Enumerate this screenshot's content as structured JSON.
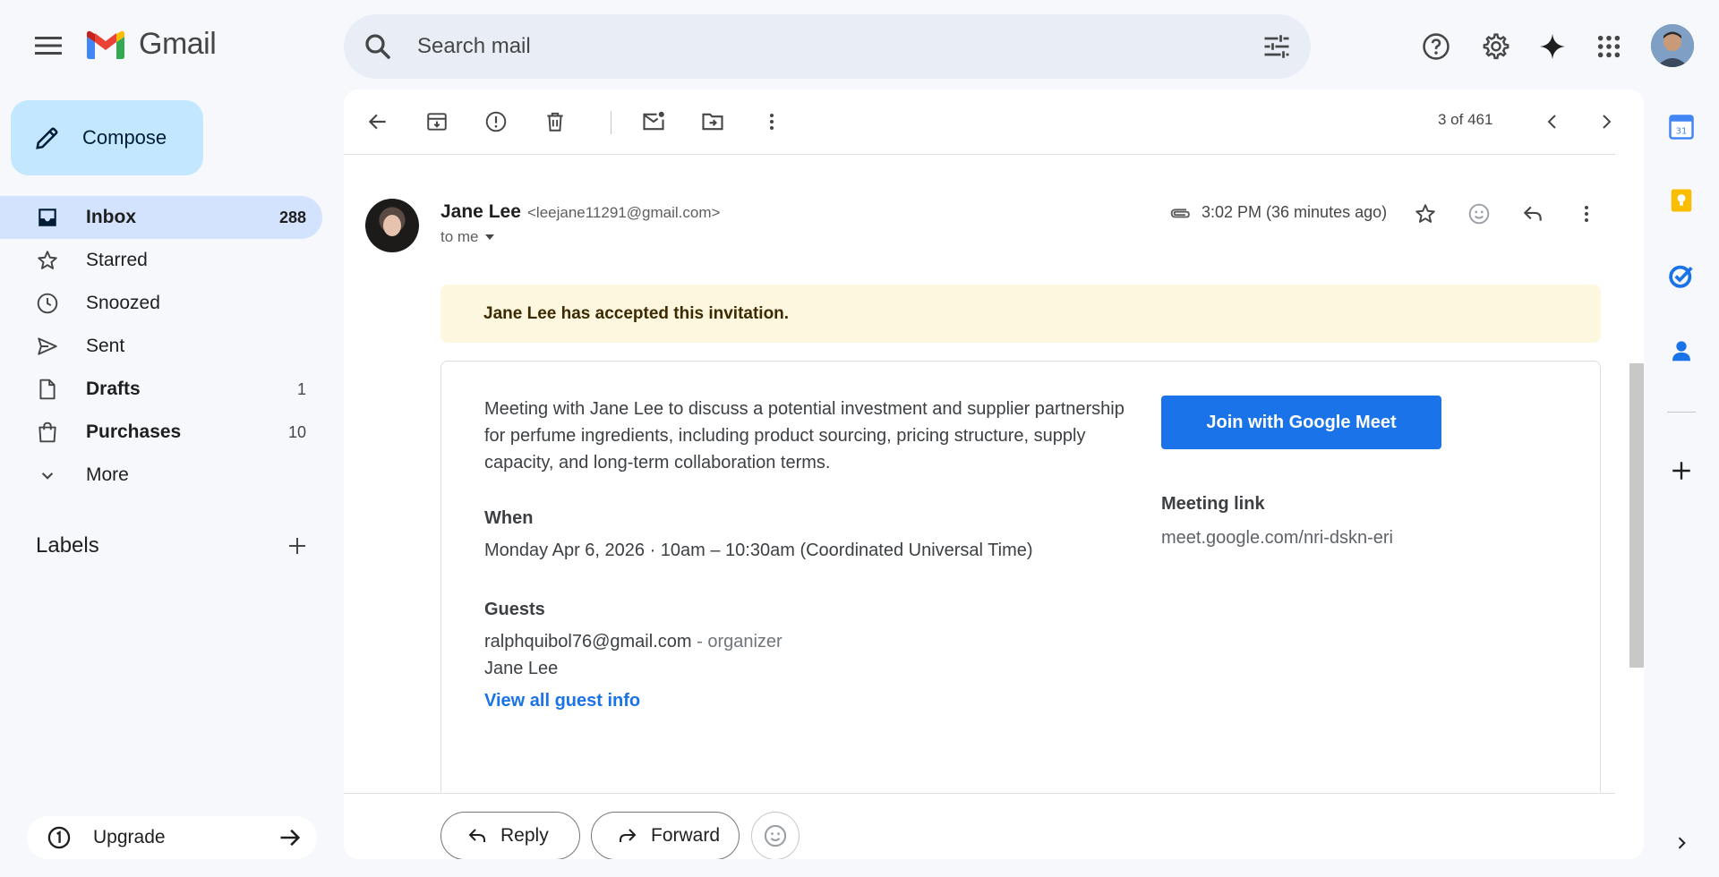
{
  "app": {
    "title": "Gmail",
    "search_placeholder": "Search mail"
  },
  "sidebar": {
    "compose_label": "Compose",
    "items": [
      {
        "label": "Inbox",
        "count": "288",
        "icon": "inbox-icon"
      },
      {
        "label": "Starred",
        "count": "",
        "icon": "star-icon"
      },
      {
        "label": "Snoozed",
        "count": "",
        "icon": "clock-icon"
      },
      {
        "label": "Sent",
        "count": "",
        "icon": "send-icon"
      },
      {
        "label": "Drafts",
        "count": "1",
        "icon": "draft-icon"
      },
      {
        "label": "Purchases",
        "count": "10",
        "icon": "shopping-bag-icon"
      },
      {
        "label": "More",
        "count": "",
        "icon": "chevron-down-icon"
      }
    ],
    "labels_title": "Labels",
    "upgrade_label": "Upgrade"
  },
  "toolbar": {
    "pager": "3 of 461"
  },
  "message": {
    "sender_name": "Jane Lee",
    "sender_email": "<leejane11291@gmail.com>",
    "recipient": "to me",
    "time": "3:02 PM (36 minutes ago)",
    "banner": "Jane Lee has accepted this invitation.",
    "invite": {
      "description": "Meeting with Jane Lee to discuss a potential investment and supplier partnership for perfume ingredients, including product sourcing, pricing structure, supply capacity, and long-term collaboration terms.",
      "when_label": "When",
      "when_value": "Monday Apr 6, 2026 · 10am – 10:30am (Coordinated Universal Time)",
      "guests_label": "Guests",
      "guest1_email": "ralphquibol76@gmail.com",
      "guest1_role": "- organizer",
      "guest2": "Jane Lee",
      "view_guests": "View all guest info",
      "join_label": "Join with Google Meet",
      "meeting_link_label": "Meeting link",
      "meeting_link": "meet.google.com/nri-dskn-eri"
    }
  },
  "reply_bar": {
    "reply_label": "Reply",
    "forward_label": "Forward"
  },
  "colors": {
    "accent": "#1a73e8",
    "compose_bg": "#c2e7ff",
    "active_nav": "#d3e3fd",
    "banner_bg": "#fef7e0"
  }
}
